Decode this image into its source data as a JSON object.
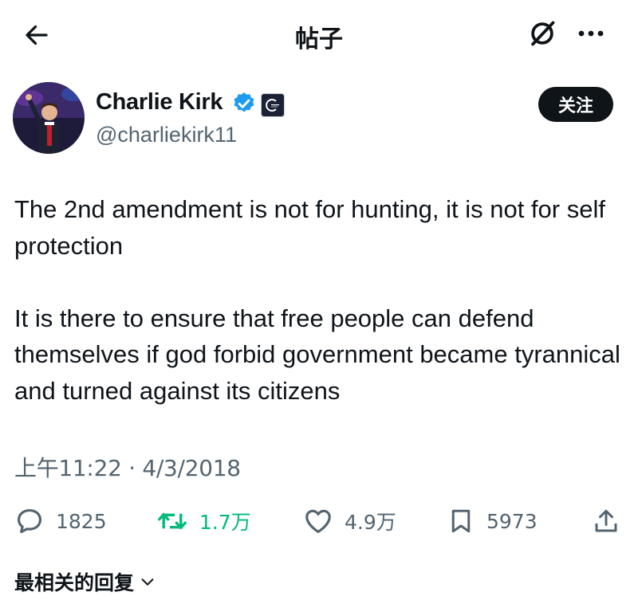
{
  "header": {
    "title": "帖子",
    "back_icon": "arrow-left-icon",
    "grok_icon": "grok-icon",
    "more_icon": "more-horizontal-icon"
  },
  "author": {
    "name": "Charlie Kirk",
    "handle": "@charliekirk11",
    "verified_color": "#1d9bf0",
    "follow_label": "关注"
  },
  "tweet": {
    "paragraphs": [
      "The 2nd amendment is not for hunting, it is not for self protection",
      "It is there to ensure that free people can defend themselves if god forbid government became tyrannical and turned against its citizens"
    ],
    "timestamp": "上午11:22 · 4/3/2018"
  },
  "actions": {
    "replies": "1825",
    "retweets": "1.7万",
    "likes": "4.9万",
    "bookmarks": "5973"
  },
  "replies_sort": {
    "label": "最相关的回复"
  },
  "colors": {
    "text": "#0f1419",
    "secondary": "#536471",
    "retweet_green": "#00ba7c",
    "verified_blue": "#1d9bf0"
  }
}
